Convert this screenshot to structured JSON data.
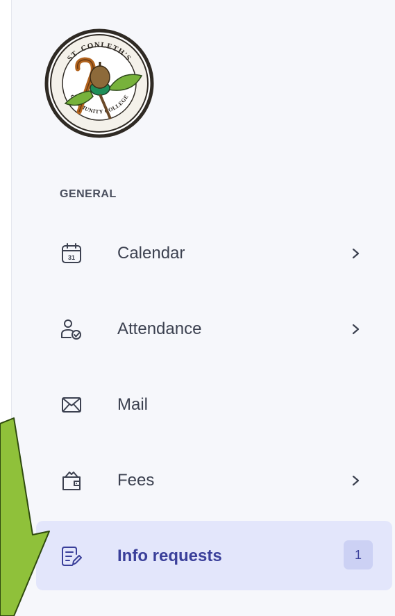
{
  "logo": {
    "name": "school-crest",
    "text_top": "ST. CONLETH'S",
    "text_bottom": "COMMUNITY COLLEGE"
  },
  "section": {
    "title": "GENERAL"
  },
  "nav": {
    "calendar": {
      "label": "Calendar",
      "icon": "calendar-icon",
      "date": "31"
    },
    "attendance": {
      "label": "Attendance",
      "icon": "user-check-icon"
    },
    "mail": {
      "label": "Mail",
      "icon": "mail-icon"
    },
    "fees": {
      "label": "Fees",
      "icon": "wallet-icon"
    },
    "info_requests": {
      "label": "Info requests",
      "icon": "edit-document-icon",
      "badge": "1",
      "active": true
    }
  },
  "colors": {
    "sidebar_bg": "#f6f7fb",
    "active_bg": "#e3e6fb",
    "active_text": "#3a3f9a",
    "badge_bg": "#ccd1f4",
    "annotation_arrow": "#8fc13a"
  }
}
